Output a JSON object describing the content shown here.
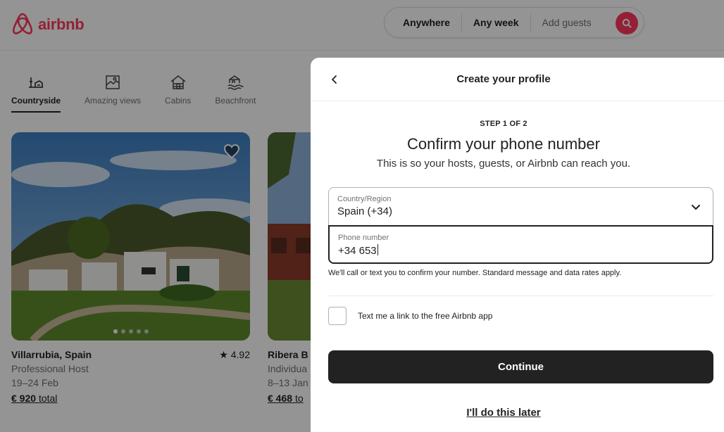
{
  "header": {
    "brand": "airbnb",
    "brand_color": "#ff385c",
    "search": {
      "where": "Anywhere",
      "when": "Any week",
      "guests": "Add guests"
    }
  },
  "categories": [
    {
      "label": "Countryside",
      "icon": "countryside-icon",
      "active": true
    },
    {
      "label": "Amazing views",
      "icon": "amazing-views-icon",
      "active": false
    },
    {
      "label": "Cabins",
      "icon": "cabins-icon",
      "active": false
    },
    {
      "label": "Beachfront",
      "icon": "beachfront-icon",
      "active": false
    }
  ],
  "listings": [
    {
      "title": "Villarrubia, Spain",
      "host": "Professional Host",
      "dates": "19–24 Feb",
      "price": "€ 920",
      "price_suffix": "total",
      "rating": "4.92"
    },
    {
      "title": "Ribera B",
      "host": "Individua",
      "dates": "8–13 Jan",
      "price": "€ 468",
      "price_suffix": "to"
    }
  ],
  "modal": {
    "title": "Create your profile",
    "step": "STEP 1 OF 2",
    "heading": "Confirm your phone number",
    "subheading": "This is so your hosts, guests, or Airbnb can reach you.",
    "country": {
      "label": "Country/Region",
      "value": "Spain (+34)"
    },
    "phone": {
      "label": "Phone number",
      "value": "+34 653"
    },
    "hint": "We'll call or text you to confirm your number. Standard message and data rates apply.",
    "checkbox_label": "Text me a link to the free Airbnb app",
    "checkbox_checked": false,
    "continue_label": "Continue",
    "later_label": "I'll do this later"
  }
}
